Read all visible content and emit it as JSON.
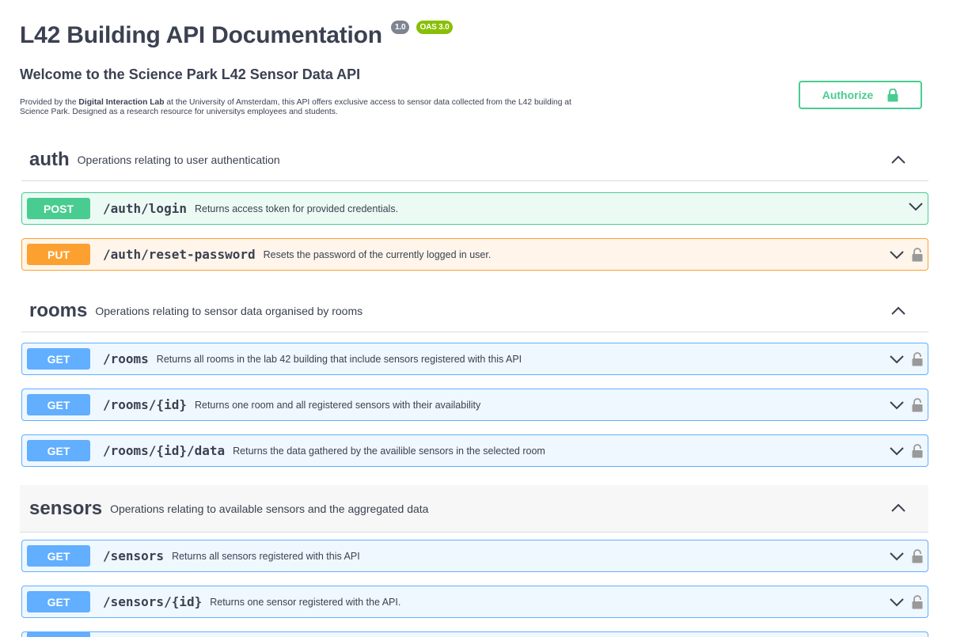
{
  "header": {
    "title": "L42 Building API Documentation",
    "version_badge": "1.0",
    "oas_badge": "OAS 3.0",
    "welcome": "Welcome to the Science Park L42 Sensor Data API",
    "description_prefix": "Provided by the ",
    "description_bold": "Digital Interaction Lab",
    "description_suffix": " at the University of Amsterdam, this API offers exclusive access to sensor data collected from the L42 building at Science Park. Designed as a research resource for universitys employees and students."
  },
  "authorize": {
    "label": "Authorize",
    "icon": "lock-icon"
  },
  "colors": {
    "post": "#49cc90",
    "put": "#fca130",
    "get": "#61affe",
    "text": "#3b4151"
  },
  "tags": [
    {
      "name": "auth",
      "description": "Operations relating to user authentication",
      "operations": [
        {
          "method": "POST",
          "path": "/auth/login",
          "summary": "Returns access token for provided credentials.",
          "locked": false
        },
        {
          "method": "PUT",
          "path": "/auth/reset-password",
          "summary": "Resets the password of the currently logged in user.",
          "locked": true
        }
      ]
    },
    {
      "name": "rooms",
      "description": "Operations relating to sensor data organised by rooms",
      "operations": [
        {
          "method": "GET",
          "path": "/rooms",
          "summary": "Returns all rooms in the lab 42 building that include sensors registered with this API",
          "locked": true
        },
        {
          "method": "GET",
          "path": "/rooms/{id}",
          "summary": "Returns one room and all registered sensors with their availability",
          "locked": true
        },
        {
          "method": "GET",
          "path": "/rooms/{id}/data",
          "summary": "Returns the data gathered by the availible sensors in the selected room",
          "locked": true
        }
      ]
    },
    {
      "name": "sensors",
      "description": "Operations relating to available sensors and the aggregated data",
      "operations": [
        {
          "method": "GET",
          "path": "/sensors",
          "summary": "Returns all sensors registered with this API",
          "locked": true
        },
        {
          "method": "GET",
          "path": "/sensors/{id}",
          "summary": "Returns one sensor registered with the API.",
          "locked": true
        }
      ]
    }
  ]
}
